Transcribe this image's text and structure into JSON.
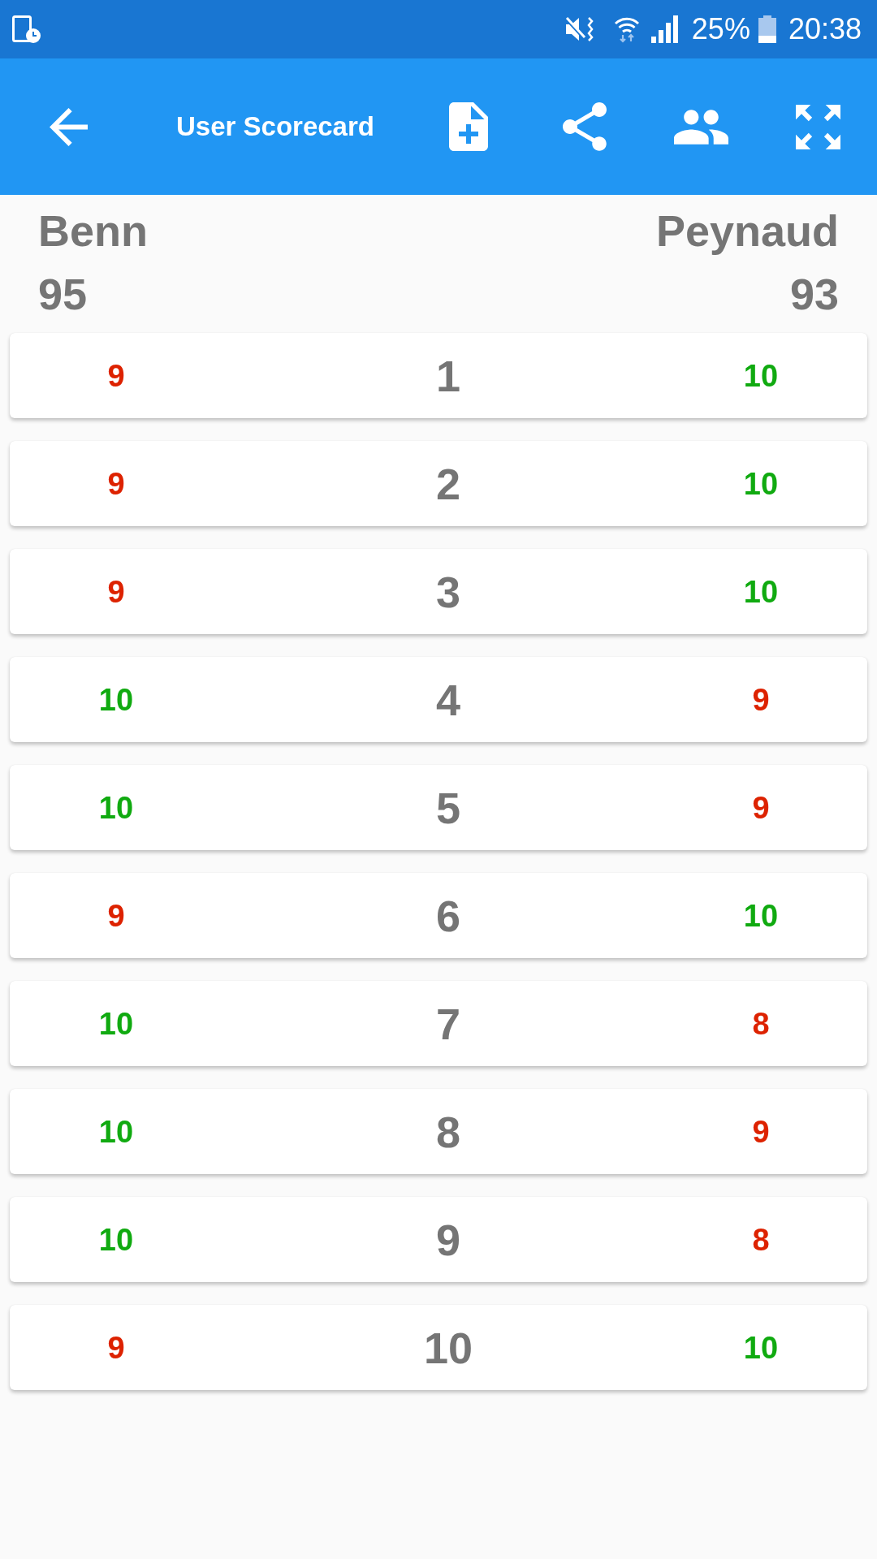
{
  "status_bar": {
    "battery": "25%",
    "time": "20:38"
  },
  "app_bar": {
    "title": "User Scorecard"
  },
  "players": [
    {
      "name": "Benn",
      "total": "95"
    },
    {
      "name": "Peynaud",
      "total": "93"
    }
  ],
  "rounds": [
    {
      "round": "1",
      "scores": [
        {
          "value": "9",
          "color": "#dd2200"
        },
        {
          "value": "10",
          "color": "#10aa10"
        }
      ]
    },
    {
      "round": "2",
      "scores": [
        {
          "value": "9",
          "color": "#dd2200"
        },
        {
          "value": "10",
          "color": "#10aa10"
        }
      ]
    },
    {
      "round": "3",
      "scores": [
        {
          "value": "9",
          "color": "#dd2200"
        },
        {
          "value": "10",
          "color": "#10aa10"
        }
      ]
    },
    {
      "round": "4",
      "scores": [
        {
          "value": "10",
          "color": "#10aa10"
        },
        {
          "value": "9",
          "color": "#dd2200"
        }
      ]
    },
    {
      "round": "5",
      "scores": [
        {
          "value": "10",
          "color": "#10aa10"
        },
        {
          "value": "9",
          "color": "#dd2200"
        }
      ]
    },
    {
      "round": "6",
      "scores": [
        {
          "value": "9",
          "color": "#dd2200"
        },
        {
          "value": "10",
          "color": "#10aa10"
        }
      ]
    },
    {
      "round": "7",
      "scores": [
        {
          "value": "10",
          "color": "#10aa10"
        },
        {
          "value": "8",
          "color": "#dd2200"
        }
      ]
    },
    {
      "round": "8",
      "scores": [
        {
          "value": "10",
          "color": "#10aa10"
        },
        {
          "value": "9",
          "color": "#dd2200"
        }
      ]
    },
    {
      "round": "9",
      "scores": [
        {
          "value": "10",
          "color": "#10aa10"
        },
        {
          "value": "8",
          "color": "#dd2200"
        }
      ]
    },
    {
      "round": "10",
      "scores": [
        {
          "value": "9",
          "color": "#dd2200"
        },
        {
          "value": "10",
          "color": "#10aa10"
        }
      ]
    }
  ]
}
